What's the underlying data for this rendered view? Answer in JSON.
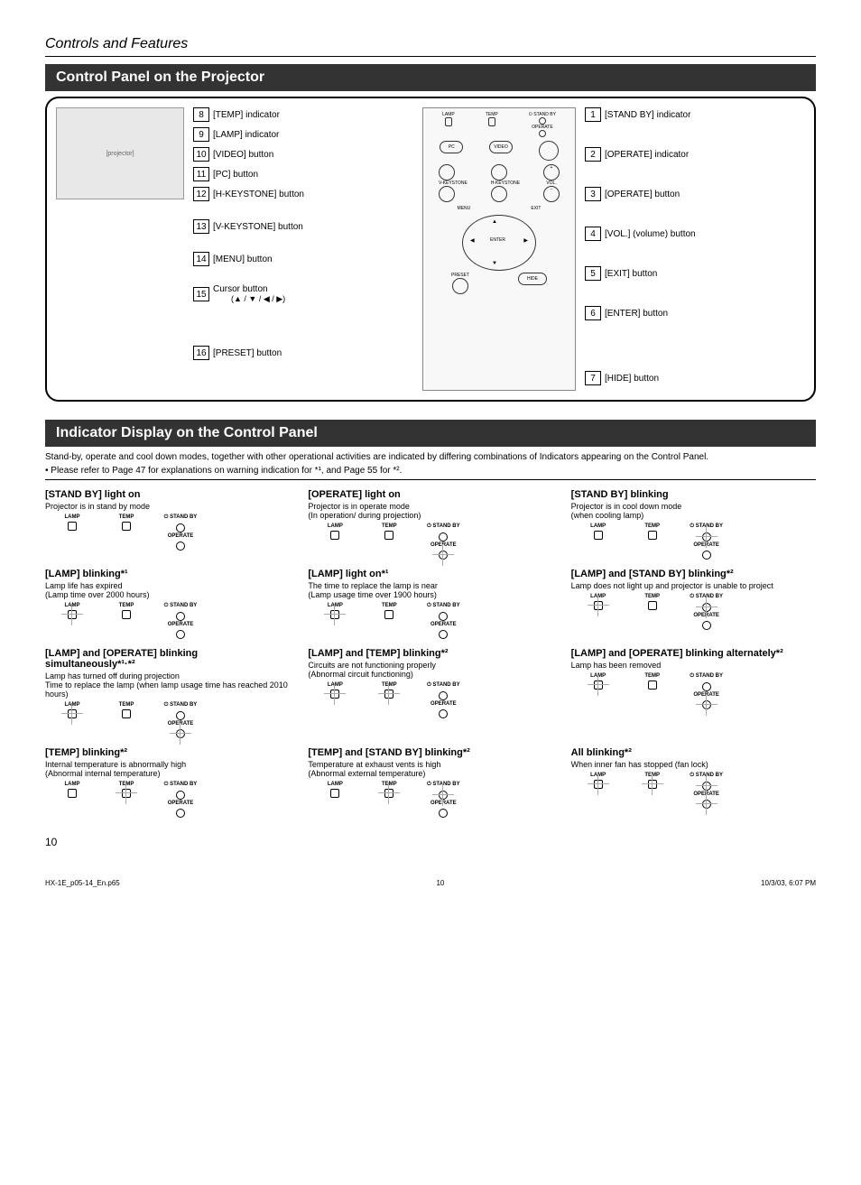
{
  "header": "Controls and Features",
  "section1_title": "Control Panel on the Projector",
  "left_labels": [
    {
      "n": "8",
      "t": "[TEMP] indicator"
    },
    {
      "n": "9",
      "t": "[LAMP] indicator"
    },
    {
      "n": "10",
      "t": "[VIDEO] button"
    },
    {
      "n": "11",
      "t": "[PC] button"
    },
    {
      "n": "12",
      "t": "[H-KEYSTONE] button"
    },
    {
      "n": "13",
      "t": "[V-KEYSTONE] button"
    },
    {
      "n": "14",
      "t": "[MENU] button"
    },
    {
      "n": "15",
      "t": "Cursor button",
      "sub": "(▲ / ▼ / ◀ / ▶)"
    },
    {
      "n": "16",
      "t": "[PRESET] button"
    }
  ],
  "right_labels": [
    {
      "n": "1",
      "t": "[STAND BY] indicator"
    },
    {
      "n": "2",
      "t": "[OPERATE] indicator"
    },
    {
      "n": "3",
      "t": "[OPERATE] button"
    },
    {
      "n": "4",
      "t": "[VOL.] (volume) button"
    },
    {
      "n": "5",
      "t": "[EXIT] button"
    },
    {
      "n": "6",
      "t": "[ENTER] button"
    },
    {
      "n": "7",
      "t": "[HIDE] button"
    }
  ],
  "panel_labels": {
    "standby": "STAND BY",
    "lamp": "LAMP",
    "temp": "TEMP",
    "operate": "OPERATE",
    "pc": "PC",
    "video": "VIDEO",
    "vkey": "V-KEYSTONE",
    "hkey": "H-KEYSTONE",
    "vol": "VOL.",
    "menu": "MENU",
    "exit": "EXIT",
    "enter": "ENTER",
    "preset": "PRESET",
    "hide": "HIDE"
  },
  "section2_title": "Indicator Display on the Control Panel",
  "intro1": "Stand-by, operate and cool down modes, together with other operational activities are indicated by differing combinations of Indicators appearing on the Control Panel.",
  "intro2": "• Please refer to Page 47 for explanations on warning indication for *¹, and Page 55 for *².",
  "led_labels": {
    "lamp": "LAMP",
    "temp": "TEMP",
    "standby": "STAND BY",
    "operate": "OPERATE"
  },
  "indicators": [
    {
      "title": "[STAND BY] light on",
      "desc": "Projector is in stand by mode",
      "blink": {
        "lamp": false,
        "temp": false,
        "standby": false,
        "operate": false
      }
    },
    {
      "title": "[OPERATE] light on",
      "desc": "Projector is in operate mode\n(In operation/ during projection)",
      "blink": {
        "lamp": false,
        "temp": false,
        "standby": false,
        "operate": true
      }
    },
    {
      "title": "[STAND BY] blinking",
      "desc": "Projector is in cool down mode\n(when cooling lamp)",
      "blink": {
        "lamp": false,
        "temp": false,
        "standby": true,
        "operate": false
      }
    },
    {
      "title": "[LAMP] blinking*¹",
      "desc": "Lamp life has expired\n(Lamp time over 2000 hours)",
      "blink": {
        "lamp": true,
        "temp": false,
        "standby": false,
        "operate": false
      }
    },
    {
      "title": "[LAMP] light on*¹",
      "desc": "The time to replace the lamp is near\n(Lamp usage time over 1900 hours)",
      "blink": {
        "lamp": true,
        "temp": false,
        "standby": false,
        "operate": false
      }
    },
    {
      "title": "[LAMP] and [STAND BY] blinking*²",
      "desc": "Lamp does not light up and projector is unable to project",
      "blink": {
        "lamp": true,
        "temp": false,
        "standby": true,
        "operate": false
      }
    },
    {
      "title": "[LAMP] and [OPERATE] blinking simultaneously*¹·*²",
      "desc": "Lamp has turned off during projection\nTime to replace the lamp (when lamp usage time has reached 2010 hours)",
      "blink": {
        "lamp": true,
        "temp": false,
        "standby": false,
        "operate": true
      }
    },
    {
      "title": "[LAMP] and [TEMP] blinking*²",
      "desc": "Circuits are not functioning properly\n(Abnormal circuit functioning)",
      "blink": {
        "lamp": true,
        "temp": true,
        "standby": false,
        "operate": false
      }
    },
    {
      "title": "[LAMP] and [OPERATE] blinking alternately*²",
      "desc": "Lamp has been removed",
      "blink": {
        "lamp": true,
        "temp": false,
        "standby": false,
        "operate": true
      }
    },
    {
      "title": "[TEMP] blinking*²",
      "desc": "Internal temperature is abnormally high\n(Abnormal internal temperature)",
      "blink": {
        "lamp": false,
        "temp": true,
        "standby": false,
        "operate": false
      }
    },
    {
      "title": "[TEMP] and [STAND BY] blinking*²",
      "desc": "Temperature at exhaust vents is high\n(Abnormal external temperature)",
      "blink": {
        "lamp": false,
        "temp": true,
        "standby": true,
        "operate": false
      }
    },
    {
      "title": "All blinking*²",
      "desc": "When inner fan has stopped (fan lock)",
      "blink": {
        "lamp": true,
        "temp": true,
        "standby": true,
        "operate": true
      }
    }
  ],
  "page_num": "10",
  "footer": {
    "file": "HX-1E_p05-14_En.p65",
    "page": "10",
    "date": "10/3/03, 6:07 PM"
  }
}
